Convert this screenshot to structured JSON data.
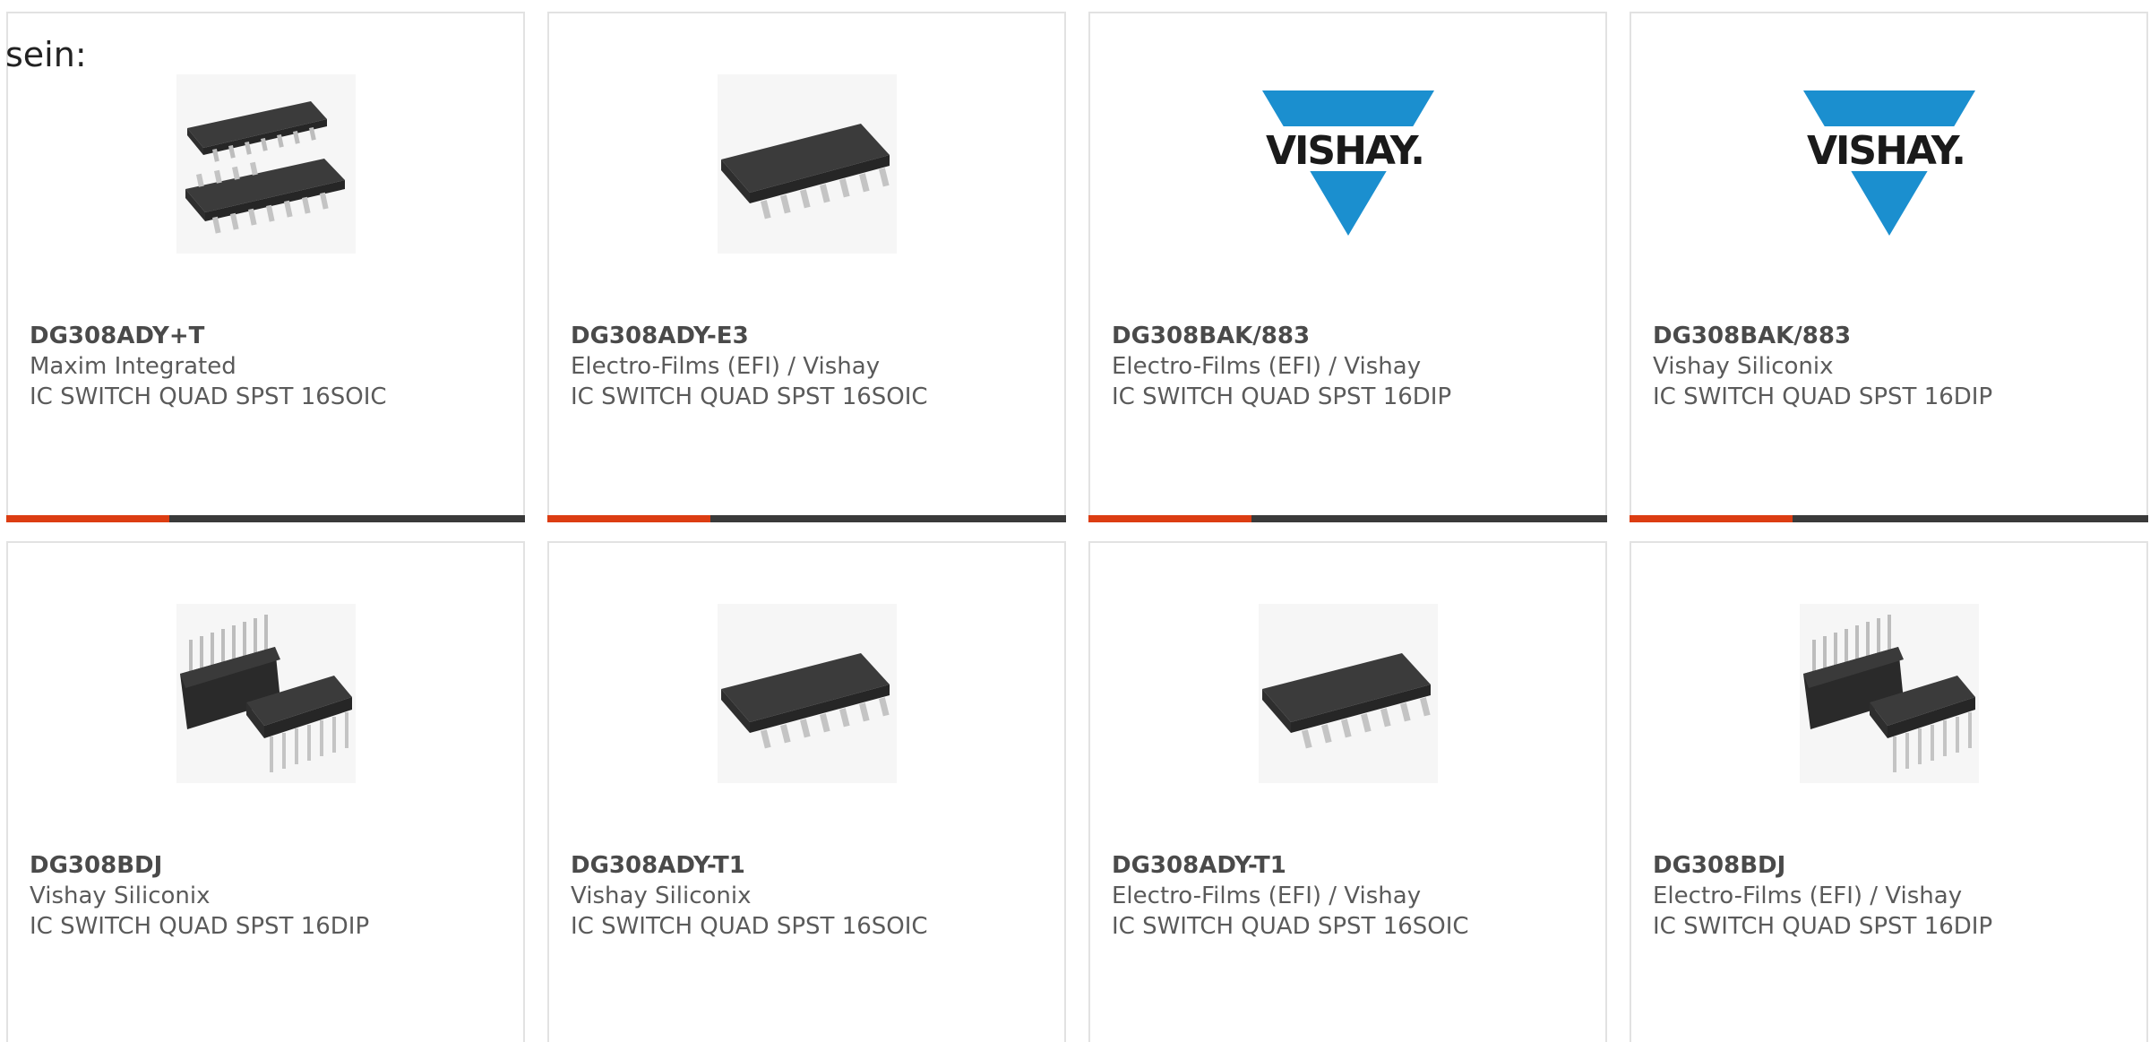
{
  "intro_text": "sein:",
  "colors": {
    "accent": "#dc3d12",
    "bar_dark": "#3a3a3a",
    "border": "#e2e2e2",
    "vishay_blue": "#1b8fcf"
  },
  "cards": [
    {
      "part": "DG308ADY+T",
      "manufacturer": "Maxim Integrated",
      "description": "IC SWITCH QUAD SPST 16SOIC",
      "image": "soic-pair-icon"
    },
    {
      "part": "DG308ADY-E3",
      "manufacturer": "Electro-Films (EFI) / Vishay",
      "description": "IC SWITCH QUAD SPST 16SOIC",
      "image": "soic-icon"
    },
    {
      "part": "DG308BAK/883",
      "manufacturer": "Electro-Films (EFI) / Vishay",
      "description": "IC SWITCH QUAD SPST 16DIP",
      "image": "vishay-logo",
      "logo_text": "VISHAY."
    },
    {
      "part": "DG308BAK/883",
      "manufacturer": "Vishay Siliconix",
      "description": "IC SWITCH QUAD SPST 16DIP",
      "image": "vishay-logo",
      "logo_text": "VISHAY."
    },
    {
      "part": "DG308BDJ",
      "manufacturer": "Vishay Siliconix",
      "description": "IC SWITCH QUAD SPST 16DIP",
      "image": "dip-pair-icon"
    },
    {
      "part": "DG308ADY-T1",
      "manufacturer": "Vishay Siliconix",
      "description": "IC SWITCH QUAD SPST 16SOIC",
      "image": "soic-icon"
    },
    {
      "part": "DG308ADY-T1",
      "manufacturer": "Electro-Films (EFI) / Vishay",
      "description": "IC SWITCH QUAD SPST 16SOIC",
      "image": "soic-icon"
    },
    {
      "part": "DG308BDJ",
      "manufacturer": "Electro-Films (EFI) / Vishay",
      "description": "IC SWITCH QUAD SPST 16DIP",
      "image": "dip-pair-icon"
    }
  ]
}
